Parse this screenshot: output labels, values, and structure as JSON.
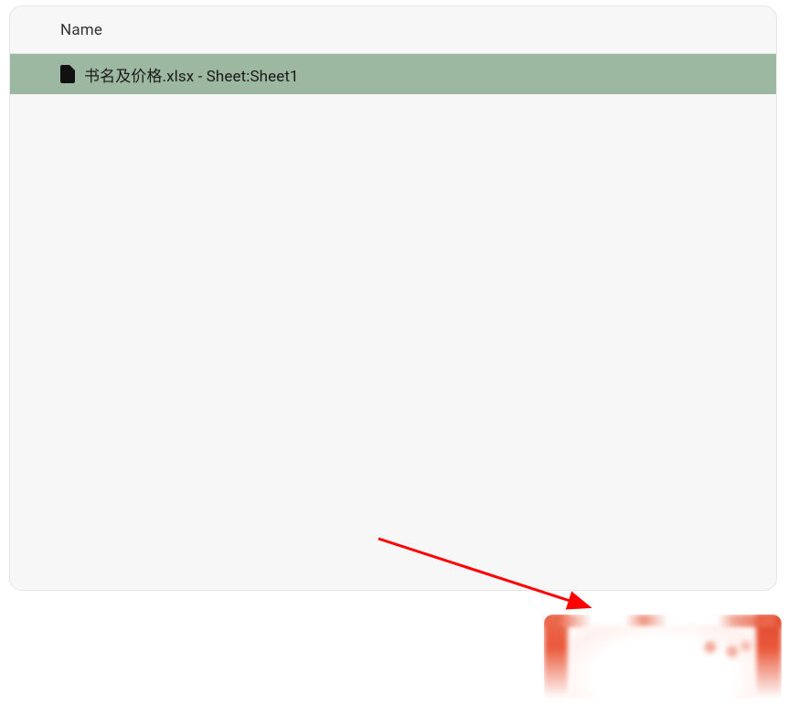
{
  "table": {
    "header": {
      "name_label": "Name"
    },
    "rows": [
      {
        "filename": "书名及价格.xlsx - Sheet:Sheet1",
        "selected": true
      }
    ]
  }
}
